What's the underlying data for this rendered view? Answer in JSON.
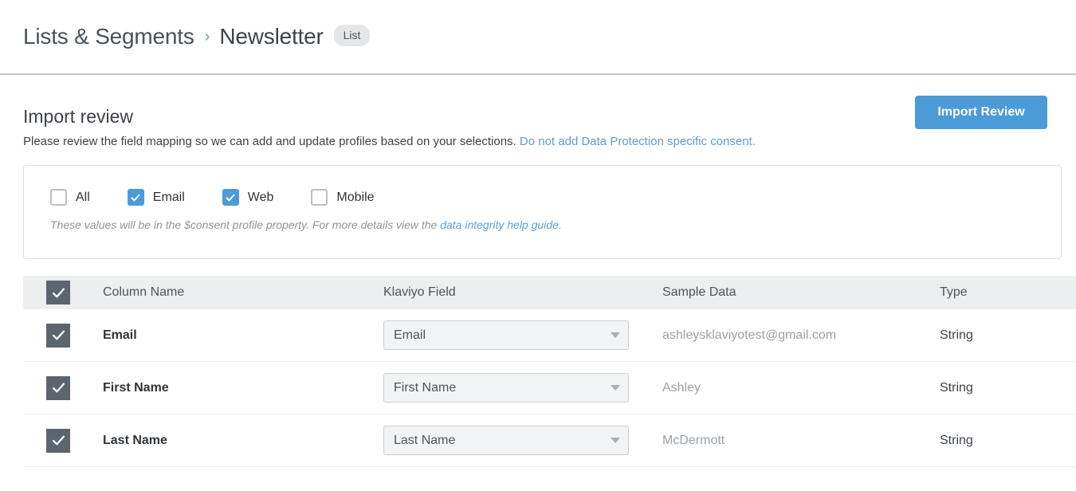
{
  "breadcrumb": {
    "root": "Lists & Segments",
    "separator": "›",
    "current": "Newsletter",
    "badge": "List"
  },
  "import_review": {
    "title": "Import review",
    "description": "Please review the field mapping so we can add and update profiles based on your selections.",
    "consent_link": "Do not add Data Protection specific consent.",
    "button_label": "Import Review"
  },
  "consent_panel": {
    "options": [
      {
        "label": "All",
        "checked": false
      },
      {
        "label": "Email",
        "checked": true
      },
      {
        "label": "Web",
        "checked": true
      },
      {
        "label": "Mobile",
        "checked": false
      }
    ],
    "note_prefix": "These values will be in the $consent profile property. For more details view the ",
    "note_link": "data integrity help guide",
    "note_suffix": "."
  },
  "table": {
    "headers": {
      "column_name": "Column Name",
      "klaviyo_field": "Klaviyo Field",
      "sample_data": "Sample Data",
      "type": "Type"
    },
    "rows": [
      {
        "selected": true,
        "column_name": "Email",
        "klaviyo_field": "Email",
        "sample_data": "ashleysklaviyotest@gmail.com",
        "type": "String"
      },
      {
        "selected": true,
        "column_name": "First Name",
        "klaviyo_field": "First Name",
        "sample_data": "Ashley",
        "type": "String"
      },
      {
        "selected": true,
        "column_name": "Last Name",
        "klaviyo_field": "Last Name",
        "sample_data": "McDermott",
        "type": "String"
      }
    ]
  },
  "colors": {
    "accent_blue": "#4a9bd8",
    "link_blue": "#5a9fd4",
    "breadcrumb_green": "#5cb85c",
    "checkbox_dark": "#5c646d",
    "header_band": "#eceeef"
  }
}
